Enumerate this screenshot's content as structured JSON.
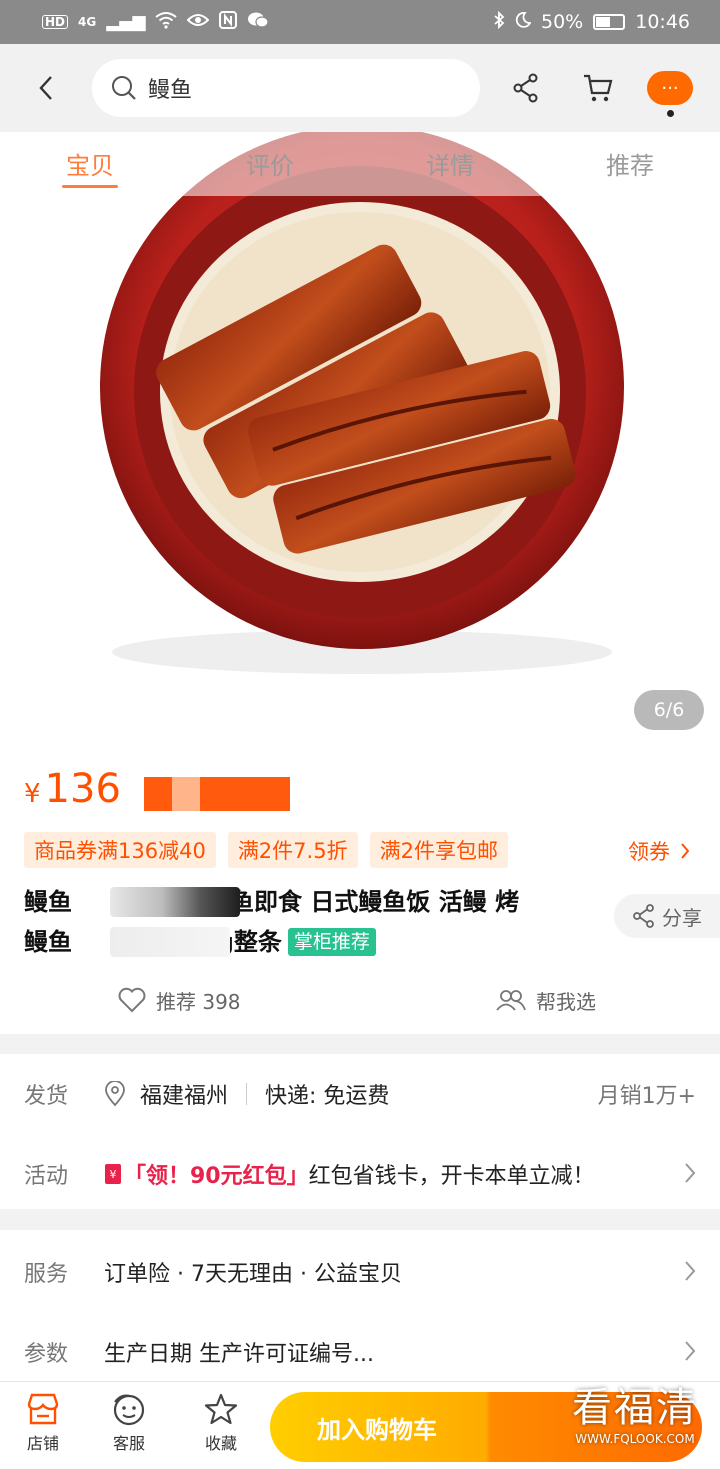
{
  "status": {
    "network": "4G",
    "battery": "50%",
    "time": "10:46"
  },
  "search": {
    "query": "鳗鱼"
  },
  "tabs": [
    "宝贝",
    "评价",
    "详情",
    "推荐"
  ],
  "gallery": {
    "counter": "6/6"
  },
  "product": {
    "price_symbol": "¥",
    "price": "136",
    "chips": [
      "商品券满136减40",
      "满2件7.5折",
      "满2件享包邮"
    ],
    "coupon_link": "领券",
    "title_line1_start": "鳗鱼",
    "title_line1_end": "鳗鱼即食 日式鳗鱼饭 活鳗 烤",
    "title_line2_start": "鳗鱼",
    "title_line2_end": "0g整条",
    "badge": "掌柜推荐",
    "share": "分享",
    "recommend": "推荐 398",
    "help": "帮我选"
  },
  "delivery": {
    "label": "发货",
    "location": "福建福州",
    "shipping": "快递: 免运费",
    "sales": "月销1万+"
  },
  "activity": {
    "label": "活动",
    "tag": "「领！90元红包」",
    "text": "红包省钱卡，开卡本单立减！"
  },
  "service": {
    "label": "服务",
    "text": "订单险 · 7天无理由 · 公益宝贝"
  },
  "params": {
    "label": "参数",
    "text": "生产日期 生产许可证编号..."
  },
  "tabbar": {
    "store": "店铺",
    "support": "客服",
    "favorite": "收藏",
    "add_to_cart": "加入购物车"
  },
  "watermark": {
    "main": "看福清",
    "url": "WWW.FQLOOK.COM"
  },
  "colors": {
    "accent": "#ff5000",
    "badge": "#27c28f",
    "cart_gradient_start": "#ffce00",
    "cart_gradient_end": "#ff6a00"
  }
}
